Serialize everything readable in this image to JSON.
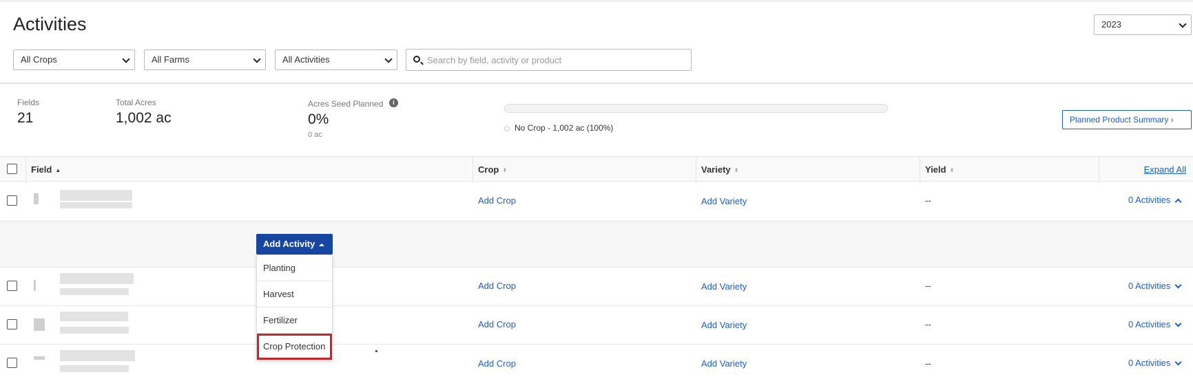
{
  "page": {
    "title": "Activities"
  },
  "year_select": {
    "value": "2023"
  },
  "filters": {
    "crops": "All Crops",
    "farms": "All Farms",
    "activities": "All Activities",
    "search_placeholder": "Search by field, activity or product"
  },
  "stats": {
    "fields_label": "Fields",
    "fields_value": "21",
    "acres_label": "Total Acres",
    "acres_value": "1,002 ac",
    "seed_label": "Acres Seed Planned",
    "seed_value": "0%",
    "seed_sub": "0 ac",
    "seed_progress_pct": 0,
    "legend": "No Crop - 1,002 ac (100%)"
  },
  "planned_summary_button": "Planned Product Summary ›",
  "table": {
    "columns": {
      "field": "Field",
      "crop": "Crop",
      "variety": "Variety",
      "yield": "Yield"
    },
    "expand_all": "Expand All",
    "rows": [
      {
        "crop": "Add Crop",
        "variety": "Add Variety",
        "yield": "--",
        "activities": "0 Activities",
        "expanded": true
      },
      {
        "crop": "Add Crop",
        "variety": "Add Variety",
        "yield": "--",
        "activities": "0 Activities",
        "expanded": false
      },
      {
        "crop": "Add Crop",
        "variety": "Add Variety",
        "yield": "--",
        "activities": "0 Activities",
        "expanded": false
      },
      {
        "crop": "Add Crop",
        "variety": "Add Variety",
        "yield": "--",
        "activities": "0 Activities",
        "expanded": false
      }
    ]
  },
  "add_activity": {
    "label": "Add Activity",
    "menu": [
      "Planting",
      "Harvest",
      "Fertilizer",
      "Crop Protection"
    ]
  },
  "colors": {
    "link": "#1a5fc8",
    "primary_button": "#1646a0",
    "highlight": "#c0282d"
  }
}
